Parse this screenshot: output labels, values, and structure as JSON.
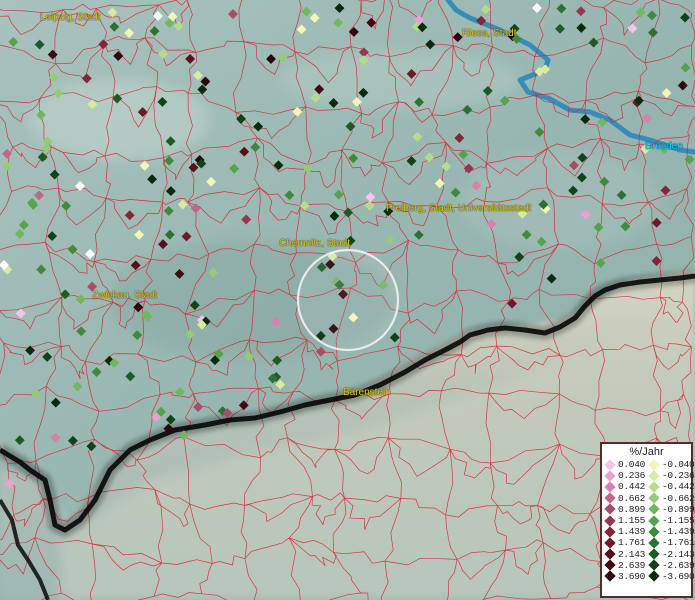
{
  "map": {
    "cities": [
      {
        "name": "Leipzig, Stadt"
      },
      {
        "name": "Riesa, Stadt"
      },
      {
        "name": "Dresden"
      },
      {
        "name": "Freiberg, Stadt, Universitätsstadt"
      },
      {
        "name": "Chemnitz, Stadt"
      },
      {
        "name": "Zwickau, Stadt"
      },
      {
        "name": "Bärenstein"
      }
    ]
  },
  "legend": {
    "title": "%/Jahr",
    "positive": [
      "0.040",
      "0.236",
      "0.442",
      "0.662",
      "0.899",
      "1.155",
      "1.439",
      "1.761",
      "2.143",
      "2.639",
      "3.690"
    ],
    "negative": [
      "-0.040",
      "-0.236",
      "-0.442",
      "-0.662",
      "-0.899",
      "-1.155",
      "-1.439",
      "-1.761",
      "-2.143",
      "-2.639",
      "-3.690"
    ],
    "positive_colors": [
      "#f7c4ec",
      "#e9a1cf",
      "#d781ae",
      "#c06687",
      "#a84d66",
      "#93384e",
      "#7e2839",
      "#6a1a28",
      "#55111c",
      "#3f0a12",
      "#2a0509"
    ],
    "negative_colors": [
      "#f2f6b8",
      "#d7eca1",
      "#b6dc8b",
      "#95cb76",
      "#72b660",
      "#56a24f",
      "#3f8a3f",
      "#2d7232",
      "#1e5a25",
      "#124219",
      "#082a0e"
    ]
  }
}
